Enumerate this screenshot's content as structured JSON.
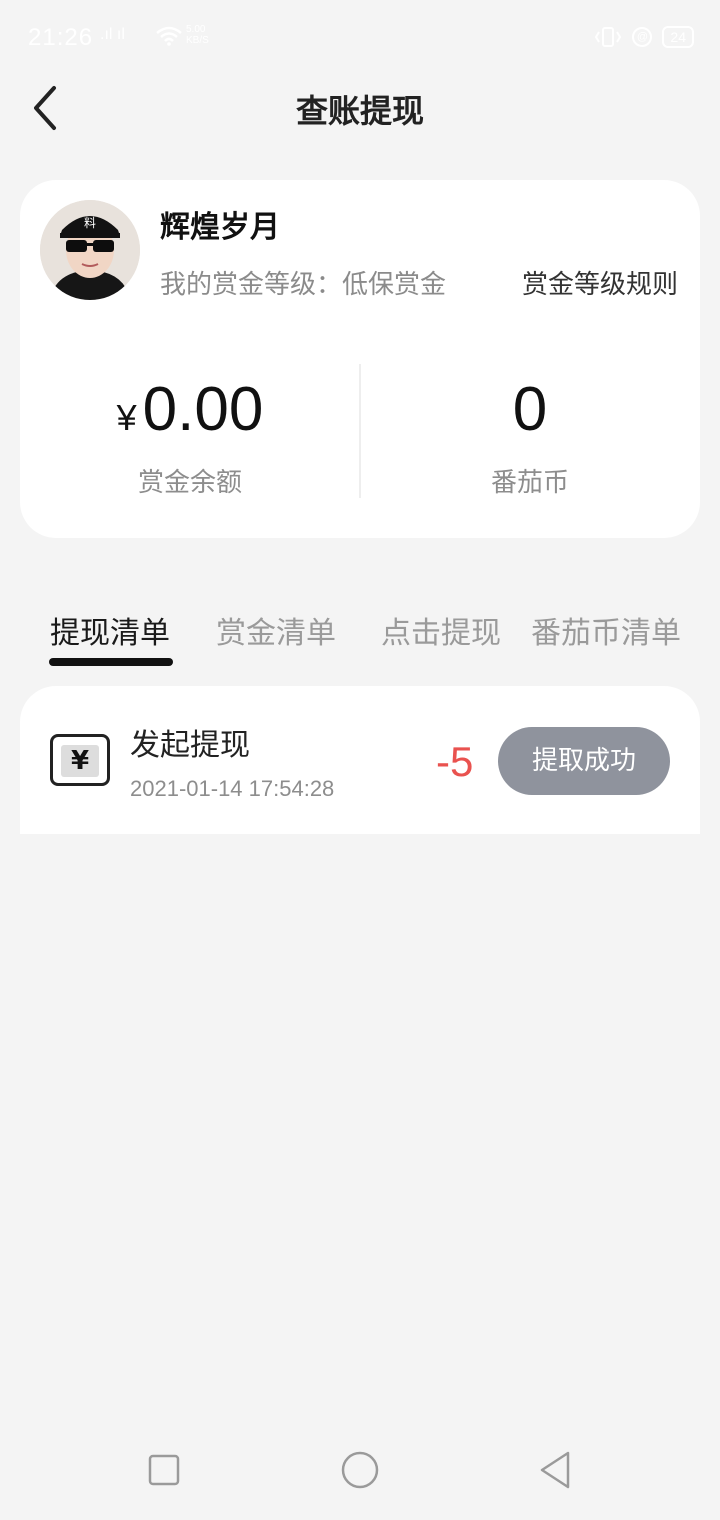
{
  "status_bar": {
    "time": "21:26",
    "signal": ".ıl ıl",
    "speed_value": "5.00",
    "speed_unit": "KB/S",
    "battery": "24"
  },
  "header": {
    "title": "查账提现",
    "back_icon": "chevron-left-icon"
  },
  "profile": {
    "nickname": "辉煌岁月",
    "level_text": "我的赏金等级：低保赏金",
    "rules_link": "赏金等级规则"
  },
  "balance": {
    "currency_symbol": "¥",
    "bounty_amount": "0.00",
    "bounty_label": "赏金余额",
    "coins_amount": "0",
    "coins_label": "番茄币"
  },
  "tabs": [
    {
      "label": "提现清单",
      "active": true
    },
    {
      "label": "赏金清单",
      "active": false
    },
    {
      "label": "点击提现",
      "active": false
    },
    {
      "label": "番茄币清单",
      "active": false
    }
  ],
  "records": [
    {
      "icon": "yen-icon",
      "icon_glyph": "¥",
      "title": "发起提现",
      "time": "2021-01-14 17:54:28",
      "amount": "-5",
      "status": "提取成功"
    }
  ],
  "colors": {
    "background": "#f4f4f4",
    "card": "#ffffff",
    "amount_negative": "#e9524f",
    "status_button": "#8f939d"
  }
}
